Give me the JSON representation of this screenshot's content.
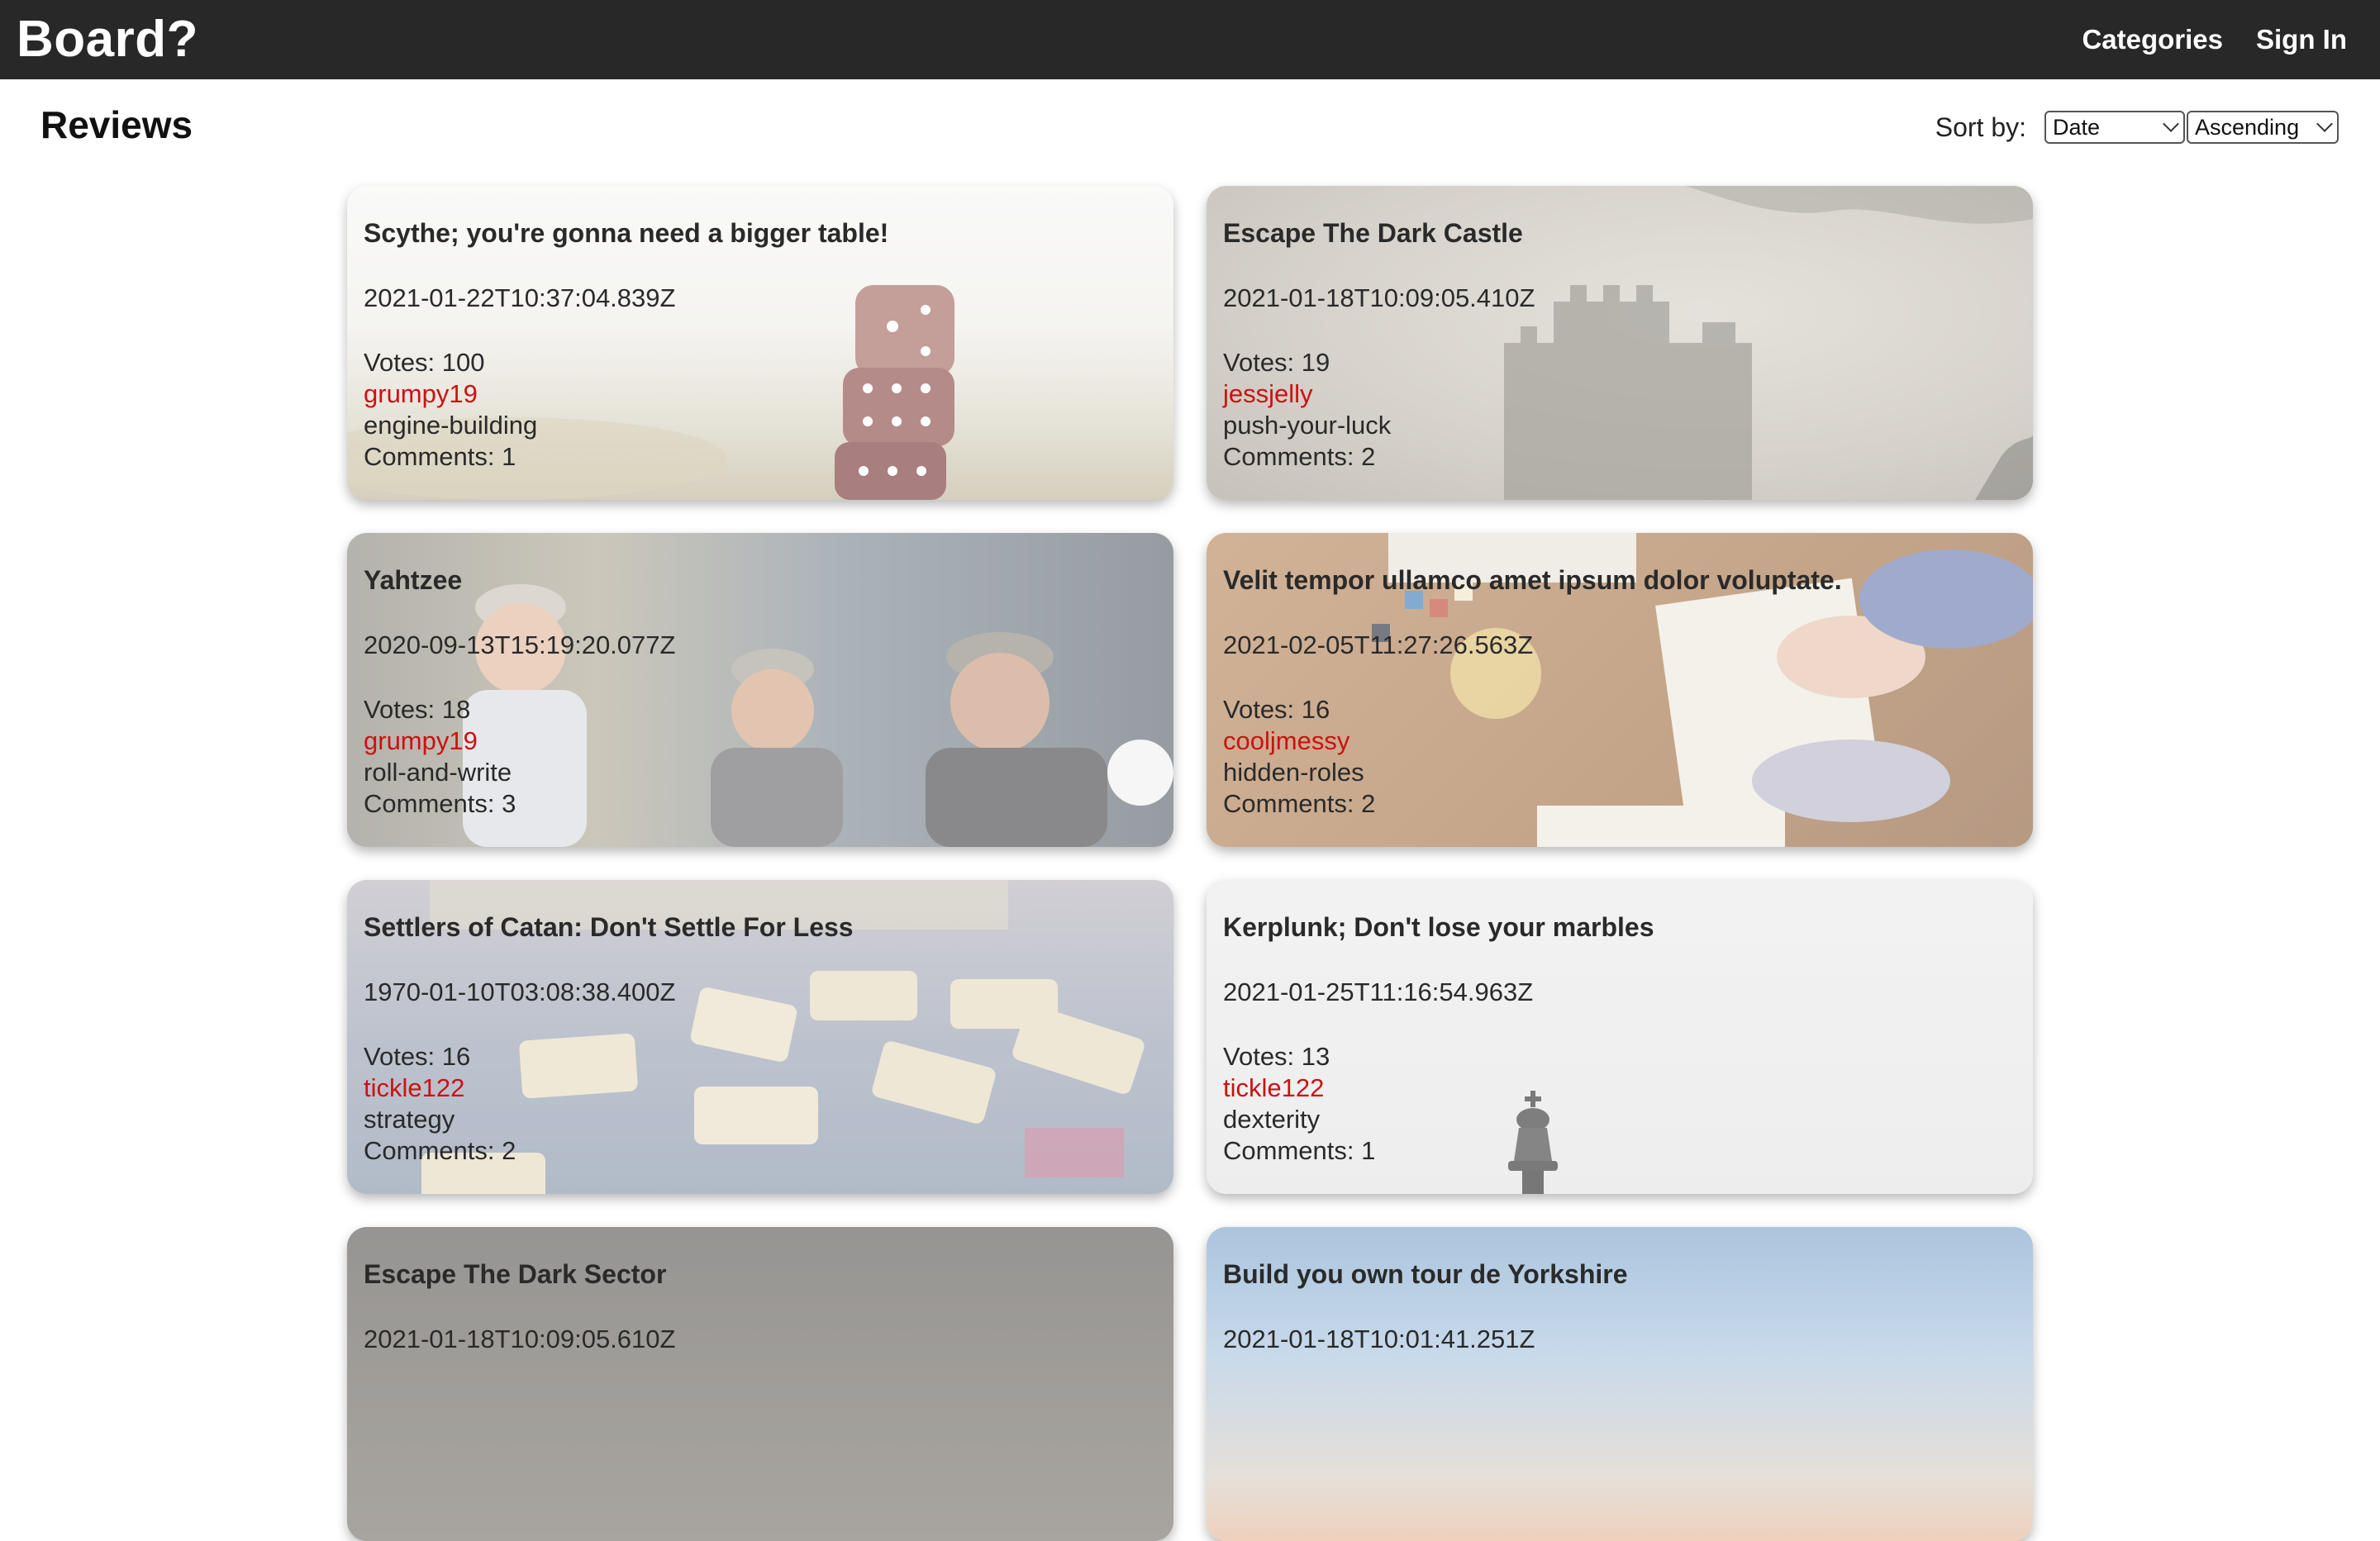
{
  "navbar": {
    "brand": "Board?",
    "links": [
      "Categories",
      "Sign In"
    ]
  },
  "page": {
    "title": "Reviews"
  },
  "sort": {
    "label": "Sort by:",
    "field_value": "Date",
    "order_value": "Ascending"
  },
  "reviews": [
    {
      "title": "Scythe; you're gonna need a bigger table!",
      "date": "2021-01-22T10:37:04.839Z",
      "votes": "Votes: 100",
      "owner": "grumpy19",
      "category": "engine-building",
      "comments": "Comments: 1"
    },
    {
      "title": "Escape The Dark Castle",
      "date": "2021-01-18T10:09:05.410Z",
      "votes": "Votes: 19",
      "owner": "jessjelly",
      "category": "push-your-luck",
      "comments": "Comments: 2"
    },
    {
      "title": "Yahtzee",
      "date": "2020-09-13T15:19:20.077Z",
      "votes": "Votes: 18",
      "owner": "grumpy19",
      "category": "roll-and-write",
      "comments": "Comments: 3"
    },
    {
      "title": "Velit tempor ullamco amet ipsum dolor voluptate.",
      "date": "2021-02-05T11:27:26.563Z",
      "votes": "Votes: 16",
      "owner": "cooljmessy",
      "category": "hidden-roles",
      "comments": "Comments: 2"
    },
    {
      "title": "Settlers of Catan: Don't Settle For Less",
      "date": "1970-01-10T03:08:38.400Z",
      "votes": "Votes: 16",
      "owner": "tickle122",
      "category": "strategy",
      "comments": "Comments: 2"
    },
    {
      "title": "Kerplunk; Don't lose your marbles",
      "date": "2021-01-25T11:16:54.963Z",
      "votes": "Votes: 13",
      "owner": "tickle122",
      "category": "dexterity",
      "comments": "Comments: 1"
    },
    {
      "title": "Escape The Dark Sector",
      "date": "2021-01-18T10:09:05.610Z"
    },
    {
      "title": "Build you own tour de Yorkshire",
      "date": "2021-01-18T10:01:41.251Z"
    }
  ]
}
